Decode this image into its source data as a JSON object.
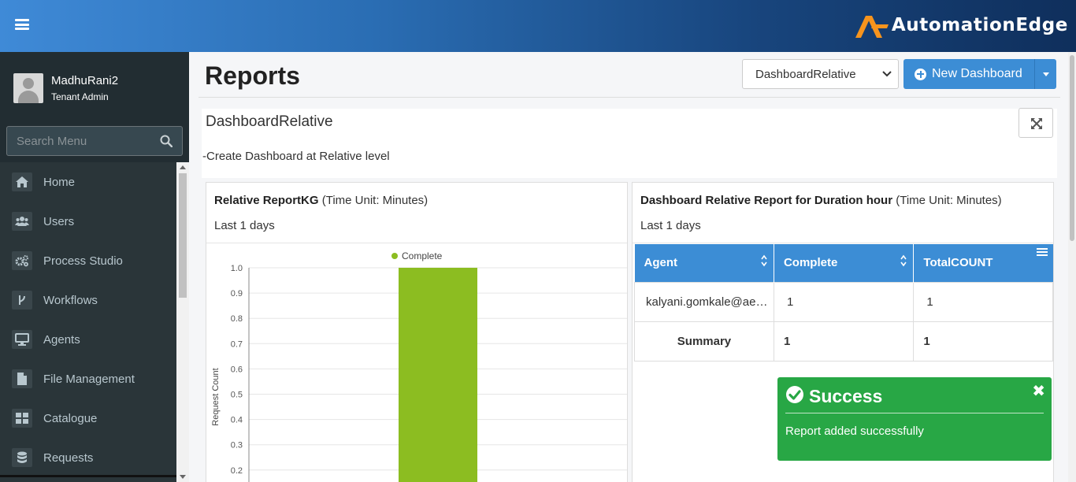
{
  "header": {
    "brand": "AutomationEdge",
    "brand_colors": {
      "logo": "#f7941d",
      "bg_start": "#3f8ad7",
      "bg_end": "#0f2f5c"
    }
  },
  "sidebar": {
    "user": {
      "name": "MadhuRani2",
      "role": "Tenant Admin"
    },
    "search": {
      "placeholder": "Search Menu"
    },
    "items": [
      {
        "label": "Home",
        "icon": "home-icon"
      },
      {
        "label": "Users",
        "icon": "users-icon"
      },
      {
        "label": "Process Studio",
        "icon": "cogs-icon"
      },
      {
        "label": "Workflows",
        "icon": "branch-icon"
      },
      {
        "label": "Agents",
        "icon": "desktop-icon"
      },
      {
        "label": "File Management",
        "icon": "file-icon"
      },
      {
        "label": "Catalogue",
        "icon": "grid-icon"
      },
      {
        "label": "Requests",
        "icon": "database-icon"
      }
    ]
  },
  "main": {
    "title": "Reports",
    "dashboard_select": {
      "selected": "DashboardRelative"
    },
    "new_dashboard_label": "New Dashboard",
    "dashboard": {
      "name": "DashboardRelative",
      "description": "-Create Dashboard at Relative level"
    },
    "left_card": {
      "title_bold": "Relative ReportKG",
      "title_rest": " (Time Unit: Minutes)",
      "subtitle": "Last 1 days"
    },
    "right_card": {
      "title_bold": "Dashboard Relative Report for Duration hour",
      "title_rest": " (Time Unit: Minutes)",
      "subtitle": "Last 1 days",
      "table": {
        "headers": [
          "Agent",
          "Complete",
          "TotalCOUNT"
        ],
        "rows": [
          [
            "kalyani.gomkale@ae…",
            "1",
            "1"
          ]
        ],
        "summary": [
          "Summary",
          "1",
          "1"
        ]
      }
    }
  },
  "toast": {
    "title": "Success",
    "message": "Report added successfully",
    "close": "✖",
    "color": "#28a745"
  },
  "chart_data": {
    "type": "bar",
    "categories": [
      ""
    ],
    "series": [
      {
        "name": "Complete",
        "values": [
          1.0
        ],
        "color": "#8cbd21"
      }
    ],
    "ylabel": "Request Count",
    "xlabel": "",
    "ylim": [
      0,
      1.0
    ],
    "yticks": [
      0.2,
      0.3,
      0.4,
      0.5,
      0.6,
      0.7,
      0.8,
      0.9,
      1.0
    ],
    "grid": true,
    "legend": "top-center"
  }
}
